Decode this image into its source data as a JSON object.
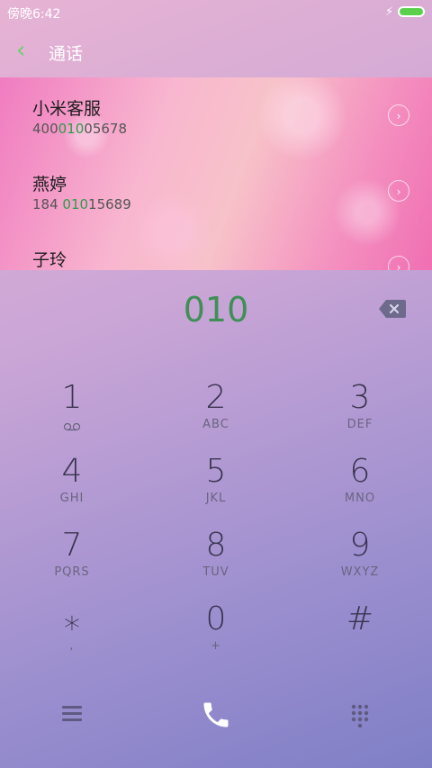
{
  "status": {
    "time": "傍晚6:42"
  },
  "header": {
    "title": "通话"
  },
  "results": [
    {
      "name": "小米客服",
      "number_pre": "400",
      "number_hl": "010",
      "number_post": "05678"
    },
    {
      "name": "燕婷",
      "number_pre": "184 ",
      "number_hl": "010",
      "number_post": "15689"
    },
    {
      "name": "子玲",
      "number_pre": "",
      "number_hl": "",
      "number_post": ""
    }
  ],
  "dial": {
    "value": "010"
  },
  "keypad": [
    {
      "digit": "1",
      "letters": ""
    },
    {
      "digit": "2",
      "letters": "ABC"
    },
    {
      "digit": "3",
      "letters": "DEF"
    },
    {
      "digit": "4",
      "letters": "GHI"
    },
    {
      "digit": "5",
      "letters": "JKL"
    },
    {
      "digit": "6",
      "letters": "MNO"
    },
    {
      "digit": "7",
      "letters": "PQRS"
    },
    {
      "digit": "8",
      "letters": "TUV"
    },
    {
      "digit": "9",
      "letters": "WXYZ"
    },
    {
      "digit": "⁎",
      "letters": ","
    },
    {
      "digit": "0",
      "letters": "+"
    },
    {
      "digit": "#",
      "letters": ""
    }
  ],
  "icons": {
    "back": "chevron-left-icon",
    "backspace": "backspace-icon",
    "voicemail": "voicemail-icon",
    "menu": "menu-icon",
    "call": "phone-icon",
    "dialpad": "dialpad-icon"
  },
  "colors": {
    "accent": "#3f8f56",
    "back_arrow": "#6ad06a",
    "battery": "#5bd14b"
  }
}
